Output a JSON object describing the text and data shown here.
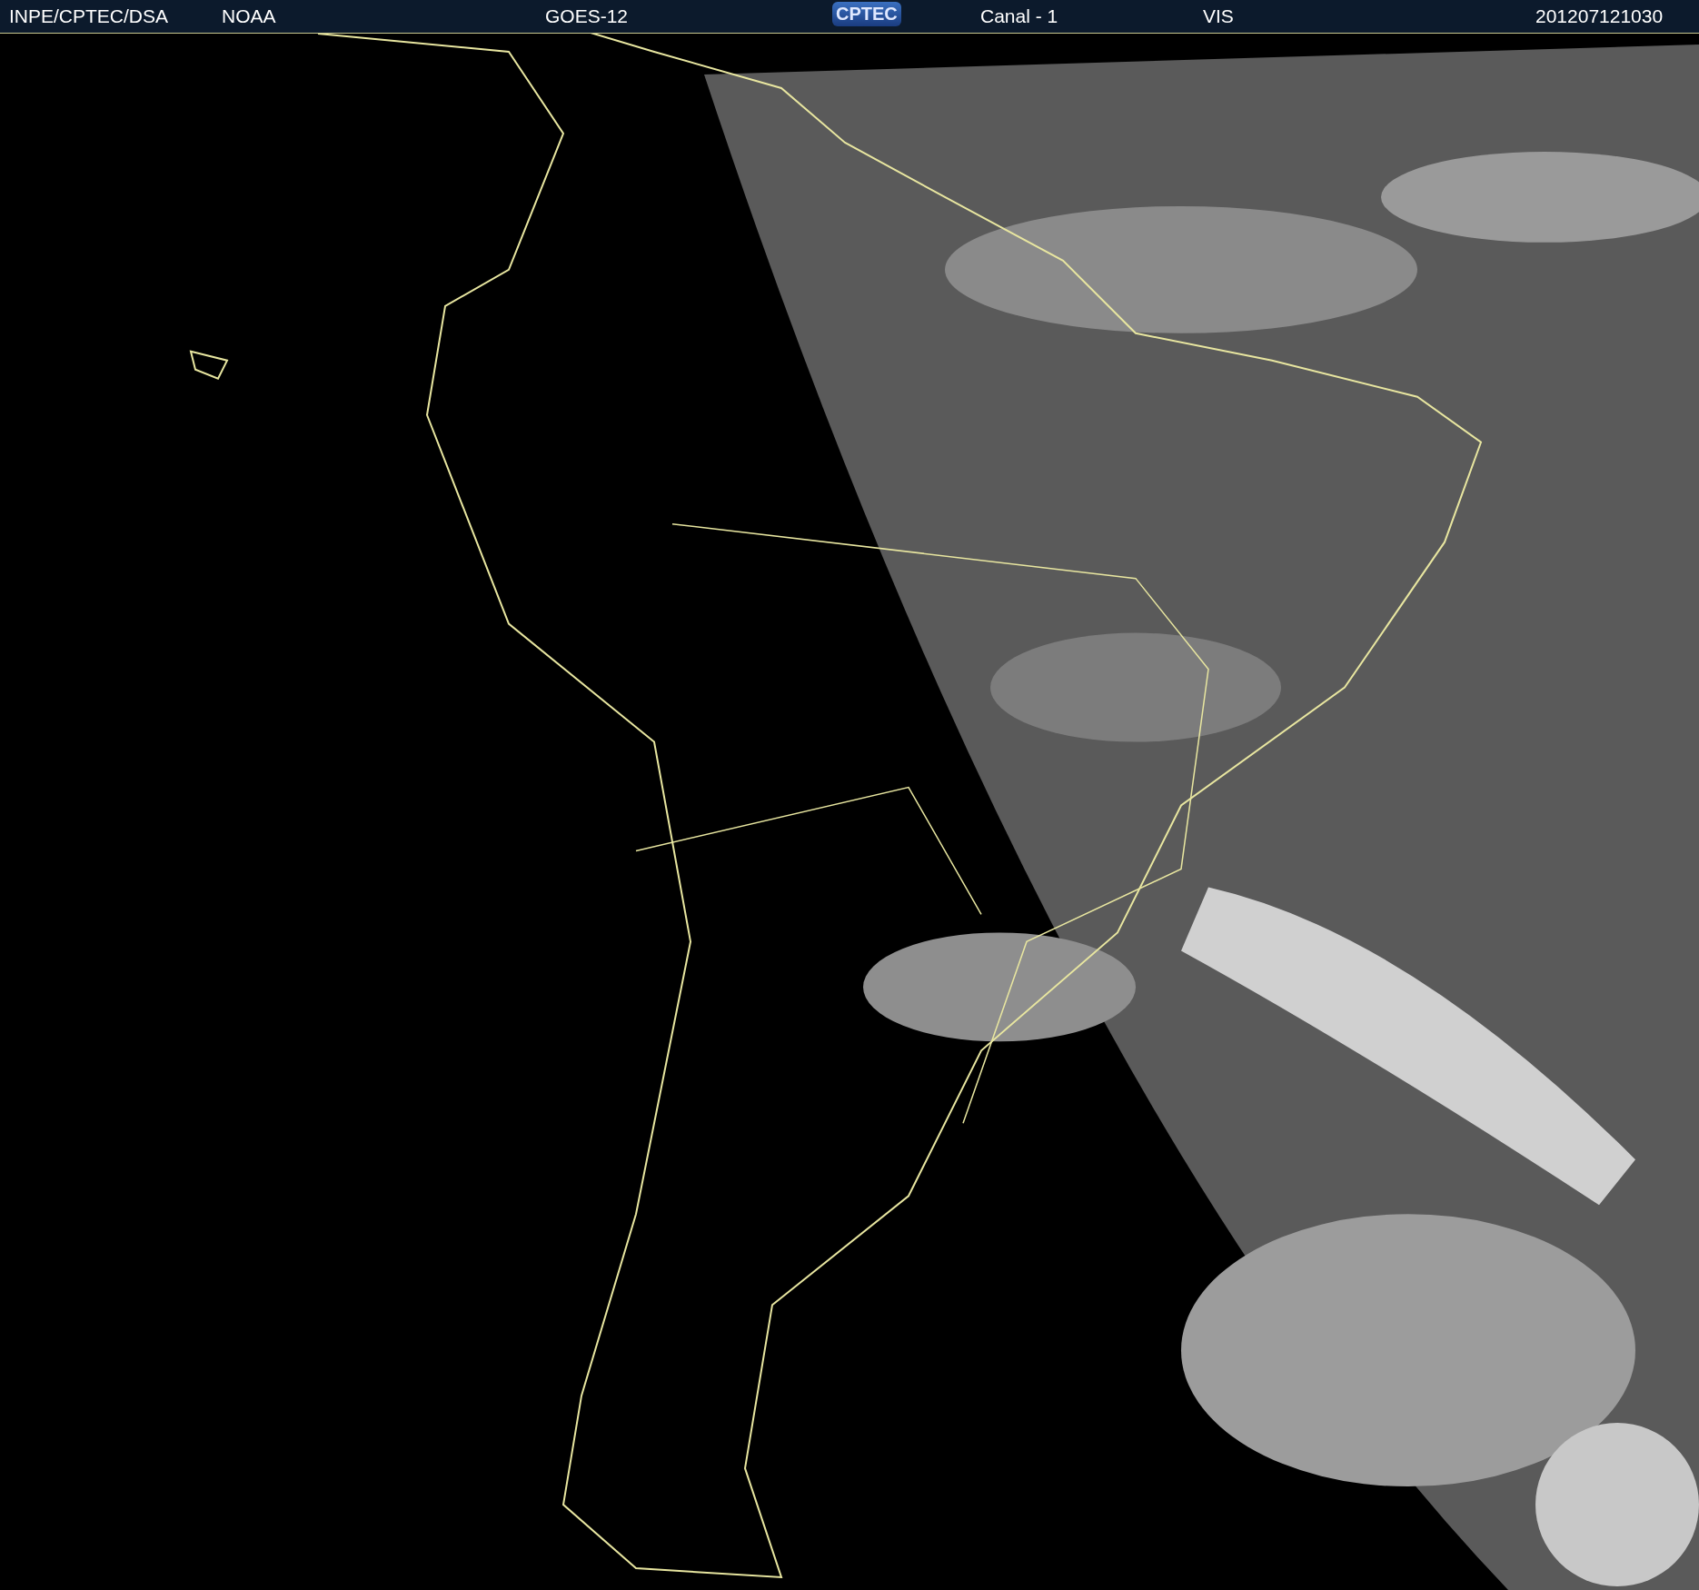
{
  "header": {
    "items": [
      {
        "kind": "text",
        "text": "INPE/CPTEC/DSA"
      },
      {
        "kind": "text",
        "text": "NOAA"
      },
      {
        "kind": "text",
        "text": "GOES-12"
      },
      {
        "kind": "logo",
        "text": "CPTEC"
      },
      {
        "kind": "text",
        "text": "Canal - 1"
      },
      {
        "kind": "text",
        "text": "VIS"
      },
      {
        "kind": "text",
        "text": "201207121030"
      }
    ]
  }
}
